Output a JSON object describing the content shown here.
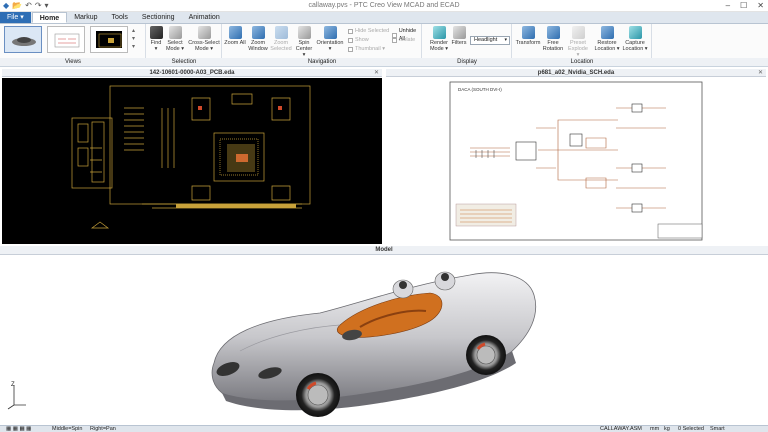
{
  "window": {
    "title": "callaway.pvs - PTC Creo View MCAD and ECAD",
    "min": "–",
    "max": "☐",
    "close": "✕"
  },
  "tabs": [
    "File",
    "Home",
    "Markup",
    "Tools",
    "Sectioning",
    "Animation"
  ],
  "tab_file_arrow": "▾",
  "ribbon": {
    "groups": {
      "views": "Views",
      "selection": "Selection",
      "navigation": "Navigation",
      "display": "Display",
      "location": "Location"
    },
    "find": "Find",
    "find_arrow": "▾",
    "select_mode": "Select",
    "select_mode2": "Mode ▾",
    "cross_select": "Cross-Select",
    "cross_select2": "Mode ▾",
    "zoom_all": "Zoom All",
    "zoom_window": "Zoom",
    "zoom_window2": "Window",
    "zoom_selected": "Zoom",
    "zoom_selected2": "Selected",
    "spin_center": "Spin",
    "spin_center2": "Center ▾",
    "orientation": "Orientation",
    "orientation2": "▾",
    "hide_selected": "Hide Selected",
    "show": "Show",
    "thumbnail": "Thumbnail ▾",
    "unhide_all": "Unhide All",
    "isolate": "Isolate",
    "render_mode": "Render",
    "render_mode2": "Mode ▾",
    "filters": "Filters",
    "headlight": "Headlight",
    "transform": "Transform",
    "free_rotation": "Free",
    "free_rotation2": "Rotation",
    "preset_explode": "Preset",
    "preset_explode2": "Explode ▾",
    "restore_location": "Restore",
    "restore_location2": "Location ▾",
    "capture_location": "Capture",
    "capture_location2": "Location ▾"
  },
  "viewports": {
    "pcb_title": "142-10601-0000-A03_PCB.eda",
    "sch_title": "p681_a02_Nvidia_SCH.eda",
    "model_title": "Model",
    "sch_label": "DACA (SOUTH DVI-I)"
  },
  "status": {
    "left1": "Middle=Spin",
    "left2": "Right=Pan",
    "assembly": "CALLAWAY.ASM",
    "units1": "mm",
    "units2": "kg",
    "selected": "0 Selected",
    "mode": "Smart"
  },
  "triad": {
    "z": "Z"
  },
  "colors": {
    "accent": "#2e6eb5",
    "pcb_bg": "#000000",
    "pcb_trace": "#c8a23a",
    "car_body": "#c9c9cc",
    "car_interior": "#d0701f"
  }
}
